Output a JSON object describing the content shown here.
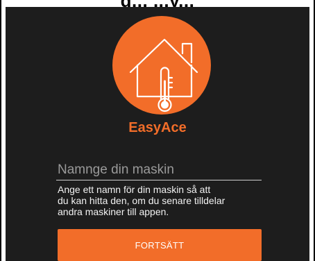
{
  "header_fragment": "g... ...y...",
  "app": {
    "name": "EasyAce",
    "logo_icon": "house-thermometer-icon"
  },
  "machine_name_input": {
    "value": "",
    "placeholder": "Namnge din maskin"
  },
  "helper_text": "Ange ett namn för din maskin så att\ndu kan hitta den, om du senare tilldelar\nandra maskiner till appen.",
  "continue_button": {
    "label": "FORTSÄTT"
  },
  "colors": {
    "accent": "#f26d29",
    "background": "#1d1d1d",
    "text": "#f2f2f2"
  }
}
